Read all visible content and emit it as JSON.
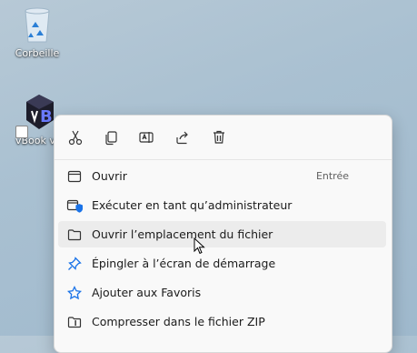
{
  "desktop": {
    "icons": [
      {
        "label": "Corbeille"
      },
      {
        "label": "vBook v"
      }
    ]
  },
  "context_menu": {
    "toolbar": [
      {
        "icon": "cut-icon"
      },
      {
        "icon": "copy-icon"
      },
      {
        "icon": "rename-icon"
      },
      {
        "icon": "share-icon"
      },
      {
        "icon": "delete-icon"
      }
    ],
    "items": [
      {
        "label": "Ouvrir",
        "shortcut": "Entrée",
        "icon": "open-app-icon"
      },
      {
        "label": "Exécuter en tant qu’administrateur",
        "icon": "admin-shield-icon"
      },
      {
        "label": "Ouvrir l’emplacement du fichier",
        "icon": "folder-icon"
      },
      {
        "label": "Épingler à l’écran de démarrage",
        "icon": "pin-icon"
      },
      {
        "label": "Ajouter aux Favoris",
        "icon": "star-icon"
      },
      {
        "label": "Compresser dans le fichier ZIP",
        "icon": "zip-icon"
      }
    ]
  },
  "colors": {
    "accent": "#1a73e8",
    "hover": "#ececec",
    "menu_bg": "#f9f9f9"
  }
}
